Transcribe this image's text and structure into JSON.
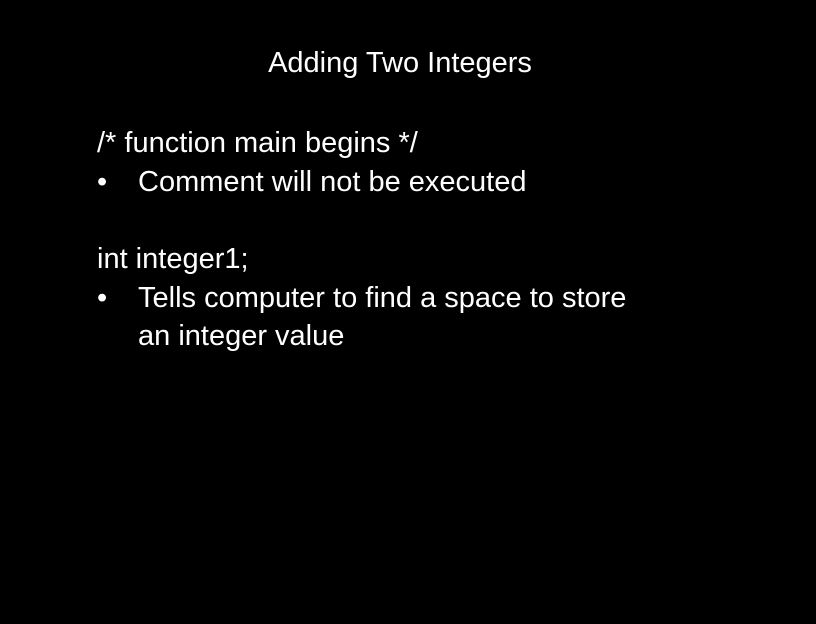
{
  "slide": {
    "title": "Adding Two Integers",
    "sections": [
      {
        "code": "/* function main begins */",
        "bullet": "Comment will not be executed"
      },
      {
        "code": "int integer1;",
        "bullet": "Tells computer to find a space to store\nan integer value"
      }
    ],
    "bullet_symbol": "•",
    "colors": {
      "background": "#000000",
      "text": "#ffffff"
    }
  }
}
